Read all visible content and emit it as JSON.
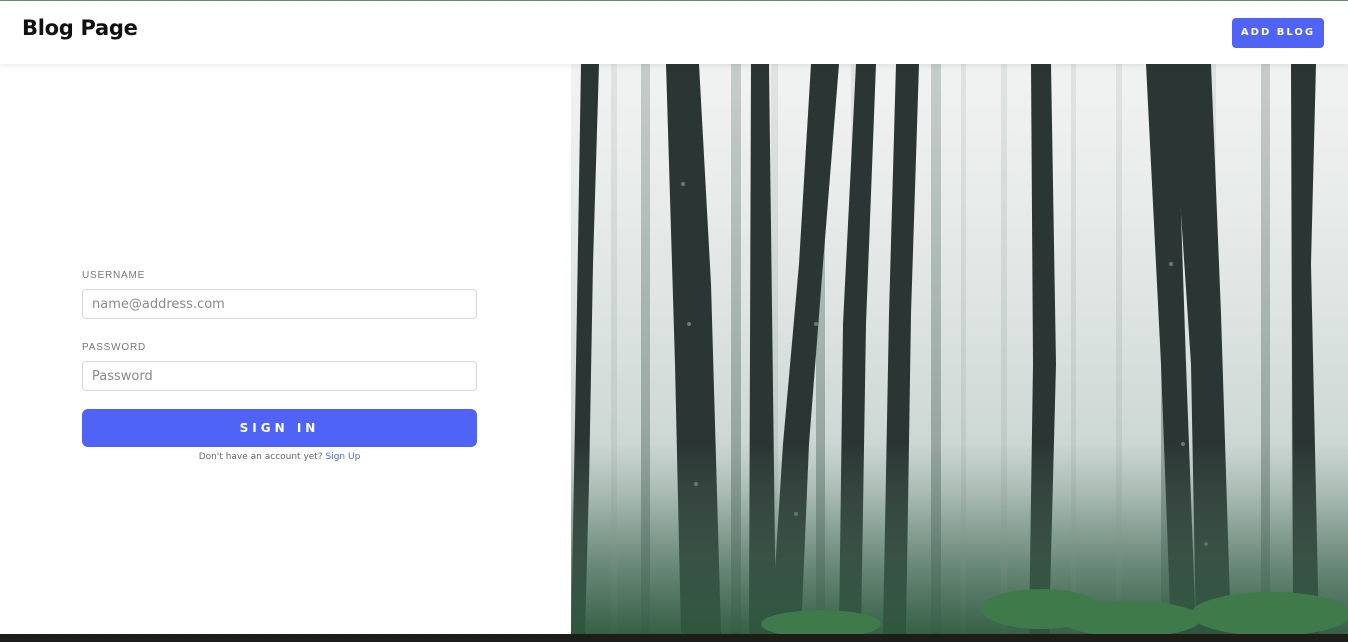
{
  "header": {
    "brand": "Blog Page",
    "add_blog_label": "ADD BLOG"
  },
  "login": {
    "username_label": "USERNAME",
    "username_placeholder": "name@address.com",
    "password_label": "PASSWORD",
    "password_placeholder": "Password",
    "sign_in_label": "SIGN IN",
    "signup_prompt": "Don't have an account yet?",
    "signup_link": "Sign Up"
  },
  "colors": {
    "accent": "#4f63f7"
  },
  "hero": {
    "image": "misty-forest-photo"
  }
}
